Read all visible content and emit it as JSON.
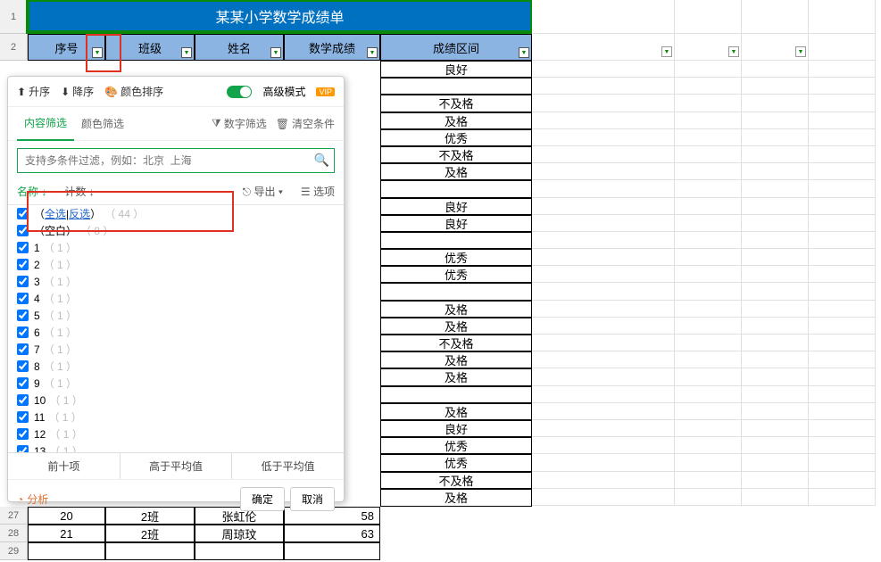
{
  "title": "某某小学数学成绩单",
  "headers": {
    "a": "序号",
    "b": "班级",
    "c": "姓名",
    "d": "数学成绩",
    "e": "成绩区间"
  },
  "rownums": {
    "r1": "1",
    "r2": "2",
    "r27": "27",
    "r28": "28",
    "r29": "29"
  },
  "gradeRows": [
    "良好",
    "",
    "不及格",
    "及格",
    "优秀",
    "不及格",
    "及格",
    "",
    "良好",
    "良好",
    "",
    "优秀",
    "优秀",
    "",
    "及格",
    "及格",
    "不及格",
    "及格",
    "及格",
    "",
    "及格",
    "良好",
    "优秀",
    "优秀",
    "不及格",
    "及格"
  ],
  "bottom": [
    {
      "a": "20",
      "b": "2班",
      "c": "张虹伦",
      "d": "58"
    },
    {
      "a": "21",
      "b": "2班",
      "c": "周琼玟",
      "d": "63"
    }
  ],
  "panel": {
    "sort_asc": "升序",
    "sort_desc": "降序",
    "color_sort": "颜色排序",
    "adv_mode": "高级模式",
    "tab_content": "内容筛选",
    "tab_color": "颜色筛选",
    "num_filter": "数字筛选",
    "clear": "清空条件",
    "search_ph": "支持多条件过滤，例如：北京  上海",
    "col_name": "名称",
    "col_count": "计数",
    "export": "导出",
    "options": "选项",
    "select_all": "全选",
    "inverse": "反选",
    "all_count": "（ 44 ）",
    "blank": "空白",
    "blank_count": "（ 8 ）",
    "items": [
      "1",
      "2",
      "3",
      "4",
      "5",
      "6",
      "7",
      "8",
      "9",
      "10",
      "11",
      "12",
      "13"
    ],
    "item_count": "（ 1 ）",
    "quick": {
      "top": "前十项",
      "above_avg": "高于平均值",
      "below_avg": "低于平均值"
    },
    "analysis": "分析",
    "ok": "确定",
    "cancel": "取消"
  }
}
